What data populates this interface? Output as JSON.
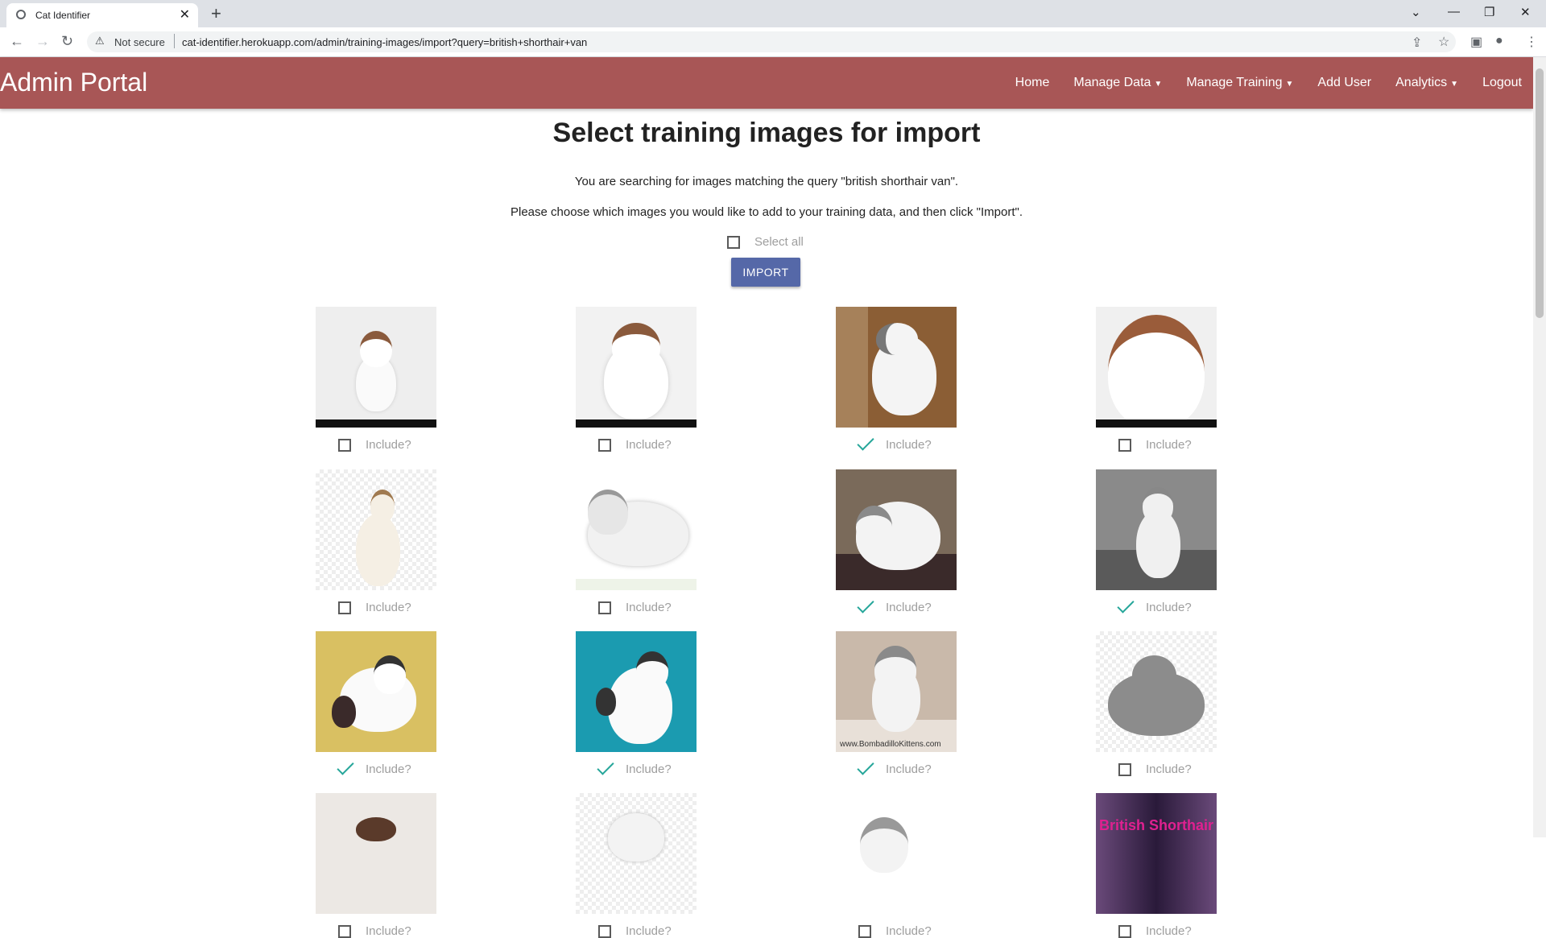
{
  "browser": {
    "tab_title": "Cat Identifier",
    "not_secure": "Not secure",
    "url": "cat-identifier.herokuapp.com/admin/training-images/import?query=british+shorthair+van"
  },
  "navbar": {
    "brand": "Admin Portal",
    "links": [
      {
        "label": "Home",
        "dropdown": false
      },
      {
        "label": "Manage Data",
        "dropdown": true
      },
      {
        "label": "Manage Training",
        "dropdown": true
      },
      {
        "label": "Add User",
        "dropdown": false
      },
      {
        "label": "Analytics",
        "dropdown": true
      },
      {
        "label": "Logout",
        "dropdown": false
      }
    ],
    "color": "#a85656"
  },
  "page": {
    "title": "Select training images for import",
    "query_text": "You are searching for images matching the query \"british shorthair van\".",
    "instructions": "Please choose which images you would like to add to your training data, and then click \"Import\".",
    "select_all_label": "Select all",
    "select_all_checked": false,
    "import_label": "IMPORT"
  },
  "images": [
    {
      "include_label": "Include?",
      "checked": false
    },
    {
      "include_label": "Include?",
      "checked": false
    },
    {
      "include_label": "Include?",
      "checked": true
    },
    {
      "include_label": "Include?",
      "checked": false
    },
    {
      "include_label": "Include?",
      "checked": false
    },
    {
      "include_label": "Include?",
      "checked": false
    },
    {
      "include_label": "Include?",
      "checked": true
    },
    {
      "include_label": "Include?",
      "checked": true
    },
    {
      "include_label": "Include?",
      "checked": true
    },
    {
      "include_label": "Include?",
      "checked": true
    },
    {
      "include_label": "Include?",
      "checked": true,
      "caption": "www.BombadilloKittens.com"
    },
    {
      "include_label": "Include?",
      "checked": false
    },
    {
      "include_label": "Include?",
      "checked": false
    },
    {
      "include_label": "Include?",
      "checked": false
    },
    {
      "include_label": "Include?",
      "checked": false
    },
    {
      "include_label": "Include?",
      "checked": false,
      "poster_text": "British Shorthair"
    }
  ]
}
